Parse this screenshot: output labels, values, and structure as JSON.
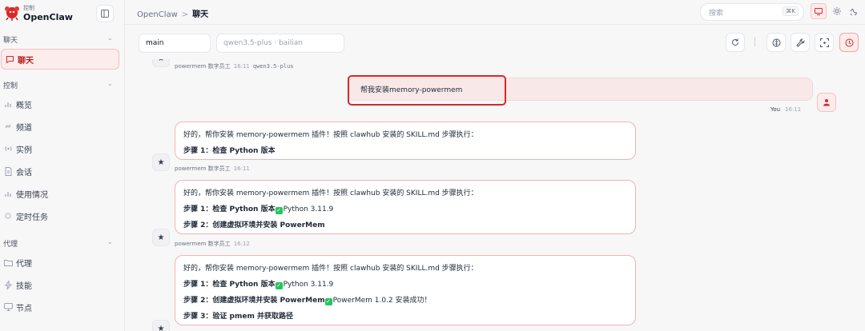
{
  "brand": {
    "subtitle": "控制",
    "name": "OpenClaw"
  },
  "sidebar": {
    "sections": [
      {
        "label": "聊天",
        "items": [
          {
            "label": "聊天",
            "icon": "chat-bubble-icon",
            "active": true
          }
        ]
      },
      {
        "label": "控制",
        "items": [
          {
            "label": "概览",
            "icon": "bar-chart-icon"
          },
          {
            "label": "频道",
            "icon": "link-icon"
          },
          {
            "label": "实例",
            "icon": "radio-signal-icon"
          },
          {
            "label": "会话",
            "icon": "document-icon"
          },
          {
            "label": "使用情况",
            "icon": "bar-chart-icon"
          },
          {
            "label": "定时任务",
            "icon": "loader-icon"
          }
        ]
      },
      {
        "label": "代理",
        "items": [
          {
            "label": "代理",
            "icon": "folder-icon"
          },
          {
            "label": "技能",
            "icon": "bolt-icon"
          },
          {
            "label": "节点",
            "icon": "monitor-icon"
          }
        ]
      }
    ]
  },
  "topbar": {
    "breadcrumb_root": "OpenClaw",
    "breadcrumb_separator": ">",
    "breadcrumb_current": "聊天",
    "search_placeholder": "搜索",
    "search_shortcut": "⌘K"
  },
  "toolbar": {
    "session_value": "main",
    "model_value": "qwen3.5-plus · bailian"
  },
  "chat": {
    "first_meta": {
      "sender": "powermem 数字员工",
      "time": "16:11",
      "model": "qwen3.5-plus"
    },
    "user_message": {
      "text": "帮我安装memory-powermem",
      "sender": "You",
      "time": "16:11"
    },
    "bot_messages": [
      {
        "lines": [
          "好的，帮你安装 memory-powermem 插件！按照 clawhub 安装的 SKILL.md 步骤执行：",
          "步骤 1：检查 Python 版本"
        ],
        "sender": "powermem 数字员工",
        "time": "16:11"
      },
      {
        "lines": [
          "好的，帮你安装 memory-powermem 插件！按照 clawhub 安装的 SKILL.md 步骤执行：",
          "步骤 1：检查 Python 版本",
          "步骤 2：创建虚拟环境并安装 PowerMem"
        ],
        "line2_result": "Python 3.11.9",
        "sender": "powermem 数字员工",
        "time": "16:12"
      },
      {
        "lines": [
          "好的，帮你安装 memory-powermem 插件！按照 clawhub 安装的 SKILL.md 步骤执行：",
          "步骤 1：检查 Python 版本",
          "步骤 2：创建虚拟环境并安装 PowerMem",
          "步骤 3：验证 pmem 并获取路径"
        ],
        "line2_result": "Python 3.11.9",
        "line3_result": "PowerMem 1.0.2 安装成功！"
      }
    ]
  },
  "colors": {
    "accent": "#dc2626",
    "accent_bg": "#fdecec",
    "success": "#22c55e"
  }
}
